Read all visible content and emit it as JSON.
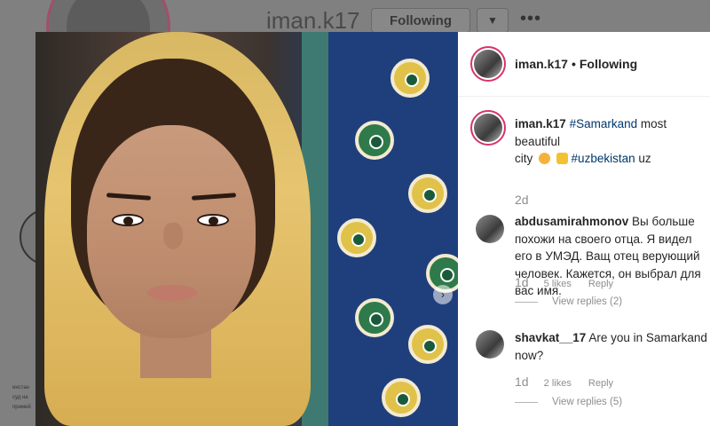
{
  "background_profile": {
    "username": "iman.k17",
    "follow_button": "Following",
    "more": "•••",
    "caption_fragment": "инстан суд на примей"
  },
  "header": {
    "username": "iman.k17",
    "separator": "•",
    "follow_state": "Following"
  },
  "caption": {
    "username": "iman.k17",
    "tag1": "#Samarkand",
    "text1": " most beautiful",
    "text2": "city",
    "tag2": "#uzbekistan",
    "text3": "uz",
    "time": "2d"
  },
  "comments": [
    {
      "username": "abdusamirahmonov",
      "text": "Вы больше похожи на своего отца. Я видел его в УМЭД. Ващ отец верующий человек. Кажется, он выбрал для вас имя.",
      "time": "1d",
      "likes": "5 likes",
      "reply": "Reply",
      "view_replies": "View replies (2)"
    },
    {
      "username": "shavkat__17",
      "text": "Are you in Samarkand now?",
      "time": "1d",
      "likes": "2 likes",
      "reply": "Reply",
      "view_replies": "View replies (5)"
    }
  ],
  "icons": {
    "next": "chevron-right-icon",
    "dropdown": "chevron-down-icon"
  },
  "colors": {
    "story_ring": "#d6336c",
    "hashtag": "#00376b",
    "muted": "#8e8e8e"
  }
}
